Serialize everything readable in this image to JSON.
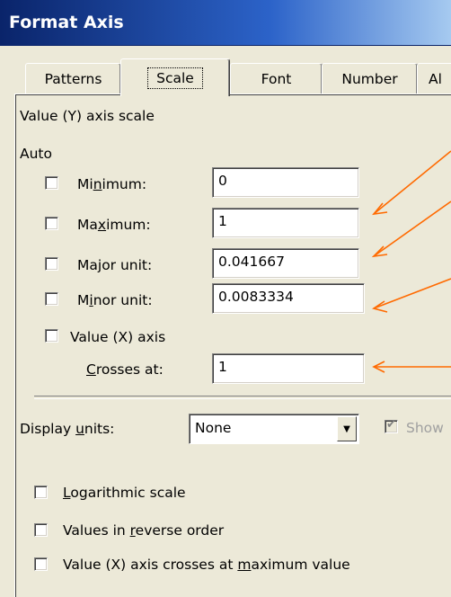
{
  "window": {
    "title": "Format Axis"
  },
  "tabs": [
    {
      "label": "Patterns"
    },
    {
      "label": "Scale"
    },
    {
      "label": "Font"
    },
    {
      "label": "Number"
    },
    {
      "label": "Al"
    }
  ],
  "scale": {
    "section_title": "Value (Y) axis scale",
    "auto_label": "Auto",
    "minimum": {
      "pre": "Mi",
      "ul": "n",
      "post": "imum:",
      "value": "0"
    },
    "maximum": {
      "pre": "Ma",
      "ul": "x",
      "post": "imum:",
      "value": "1"
    },
    "major_unit": {
      "pre": "Ma",
      "ul": "j",
      "post": "or unit:",
      "value": "0.041667"
    },
    "minor_unit": {
      "pre": "M",
      "ul": "i",
      "post": "nor unit:",
      "value": "0.0083334"
    },
    "value_x_axis_label": "Value (X) axis",
    "crosses_at": {
      "ul": "C",
      "post": "rosses at:",
      "value": "1"
    }
  },
  "display_units": {
    "pre": "Display ",
    "ul": "u",
    "post": "nits:",
    "selected": "None",
    "show_label": "Show"
  },
  "options": {
    "logarithmic": {
      "ul": "L",
      "post": "ogarithmic scale"
    },
    "reverse": {
      "pre": "Values in ",
      "ul": "r",
      "post": "everse order"
    },
    "crosses_max": {
      "pre": "Value (X) axis crosses at ",
      "ul": "m",
      "post": "aximum value"
    }
  },
  "colors": {
    "title_bar": "#0a246a",
    "annotation_arrow": "#ff6a00",
    "dialog_bg": "#ece9d8"
  }
}
